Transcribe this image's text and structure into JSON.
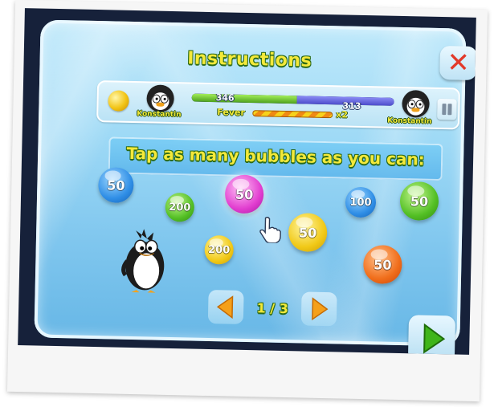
{
  "title": "Instructions",
  "close_button": "✕",
  "scorebar": {
    "left_player": "Konstantin",
    "right_player": "Konstantin",
    "left_score": "346",
    "right_score": "313",
    "fever_label": "Fever",
    "fever_multiplier": "x2",
    "green_share": 0.52
  },
  "instruction": "Tap as many bubbles as you can:",
  "bubbles": [
    {
      "value": "50",
      "color": "blue"
    },
    {
      "value": "200",
      "color": "green"
    },
    {
      "value": "50",
      "color": "pink"
    },
    {
      "value": "100",
      "color": "blue"
    },
    {
      "value": "50",
      "color": "green"
    },
    {
      "value": "50",
      "color": "yellow"
    },
    {
      "value": "200",
      "color": "yellow"
    },
    {
      "value": "50",
      "color": "orange"
    }
  ],
  "pager": {
    "indicator": "1 / 3"
  },
  "colors": {
    "title_yellow": "#f4e93a",
    "outline_green": "#2c6a17",
    "close_red": "#e23a2a",
    "arrow_orange": "#f5a01a",
    "play_green": "#3fb51a"
  },
  "icons": [
    "close-icon",
    "coin-icon",
    "pause-icon",
    "hand-pointer-icon",
    "prev-arrow-icon",
    "next-arrow-icon",
    "play-icon"
  ]
}
